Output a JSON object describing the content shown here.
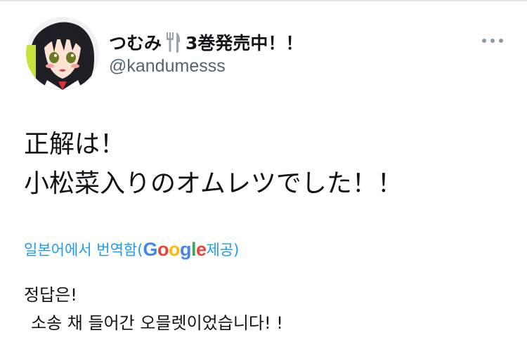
{
  "tweet": {
    "author": {
      "display_name_prefix": "つむみ",
      "display_name_suffix": "3巻発売中！！",
      "name_icon": "fork-and-knife-icon",
      "handle": "@kandumesss",
      "avatar": "anime-girl-avatar"
    },
    "more_icon": "more-horizontal-icon",
    "text_lines": [
      "正解は！",
      "小松菜入りのオムレツでした！！"
    ],
    "translation": {
      "label_prefix": "일본어에서 번역함(",
      "provider_letters": [
        "G",
        "o",
        "o",
        "g",
        "l",
        "e"
      ],
      "label_suffix": " 제공)",
      "lines": [
        "정답은!",
        "소송 채 들어간 오믈렛이었습니다! !"
      ]
    }
  },
  "colors": {
    "text": "#0f1419",
    "secondary": "#536471",
    "link": "#1d9bf0",
    "google_blue": "#4285f4",
    "google_red": "#ea4335",
    "google_yellow": "#fbbc05",
    "google_green": "#34a853"
  }
}
